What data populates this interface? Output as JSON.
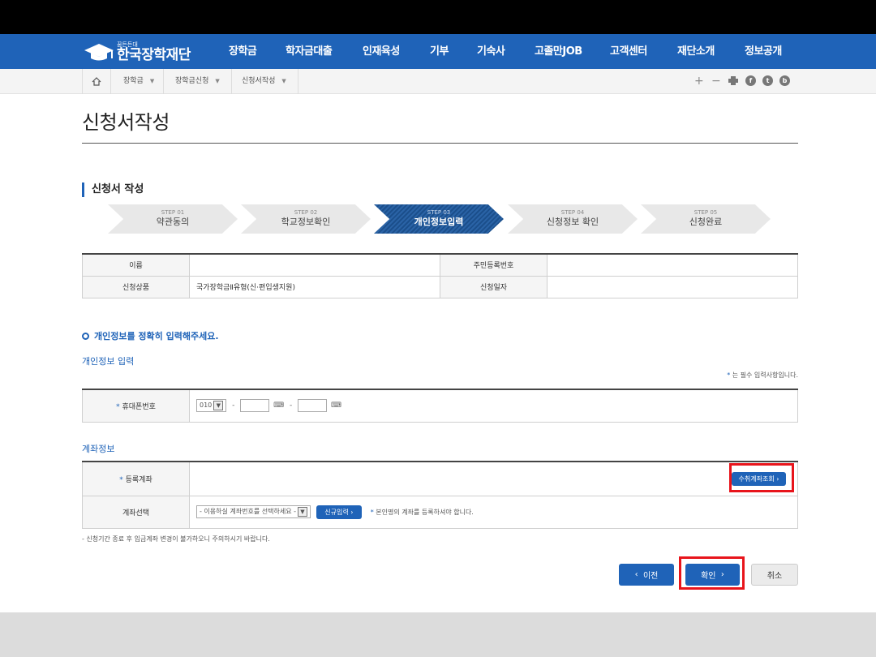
{
  "header": {
    "logo_small": "꿈든든대",
    "logo_name": "한국장학재단",
    "menu": [
      "장학금",
      "학자금대출",
      "인재육성",
      "기부",
      "기숙사",
      "고졸만JOB",
      "고객센터",
      "재단소개",
      "정보공개"
    ]
  },
  "breadcrumb": {
    "items": [
      "장학금",
      "장학금신청",
      "신청서작성"
    ],
    "util": {
      "plus": "+",
      "minus": "−"
    },
    "sns": [
      "f",
      "t",
      "b"
    ]
  },
  "page_title": "신청서작성",
  "section_title": "신청서 작성",
  "steps": [
    {
      "no": "STEP 01",
      "label": "약관동의"
    },
    {
      "no": "STEP 02",
      "label": "학교정보확인"
    },
    {
      "no": "STEP 03",
      "label": "개인정보입력",
      "active": true
    },
    {
      "no": "STEP 04",
      "label": "신청정보 확인"
    },
    {
      "no": "STEP 05",
      "label": "신청완료"
    }
  ],
  "info": {
    "name_label": "이름",
    "name_value": "",
    "rrn_label": "주민등록번호",
    "rrn_value": "",
    "product_label": "신청상품",
    "product_value": "국가장학금Ⅱ유형(신·편입생지원)",
    "date_label": "신청일자",
    "date_value": ""
  },
  "notice": "개인정보를 정확히 입력해주세요.",
  "personal": {
    "title": "개인정보 입력",
    "required_note_star": "*",
    "required_note": "는 필수 입력사항입니다.",
    "mobile_label": "휴대폰번호",
    "mobile_prefix": "010",
    "mobile_mid": "",
    "mobile_last": ""
  },
  "account": {
    "title": "계좌정보",
    "registered_label": "등록계좌",
    "lookup_button": "수취계좌조회",
    "select_label": "계좌선택",
    "select_placeholder": "- 이용하실 계좌번호를 선택하세요 -",
    "new_button": "신규입력",
    "select_hint": "본인명의 계좌를 등록하셔야 합니다."
  },
  "footer_note": "- 신청기간 종료 후 입금계좌 변경이 불가하오니 주의하시기 바랍니다.",
  "buttons": {
    "prev": "이전",
    "confirm": "확인",
    "cancel": "취소"
  },
  "colors": {
    "primary": "#1f63b8",
    "highlight": "#e8141b",
    "topbar": "#000000"
  }
}
